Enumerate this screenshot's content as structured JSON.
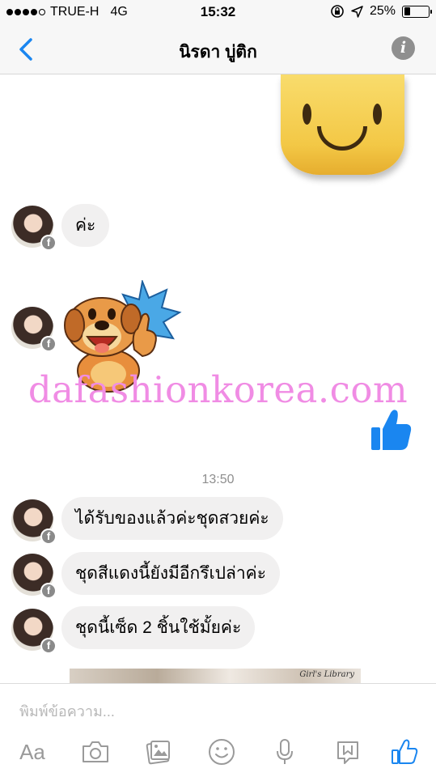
{
  "status_bar": {
    "carrier": "TRUE-H",
    "network": "4G",
    "time": "15:32",
    "battery_text": "25%",
    "battery_level": 0.25,
    "signal_bars_filled": 4,
    "signal_bars_total": 5
  },
  "header": {
    "title": "นิรดา บู่ติก",
    "info_label": "i"
  },
  "conversation": {
    "messages_before": [
      {
        "text": "ค่ะ"
      }
    ],
    "timestamp": "13:50",
    "messages_after": [
      {
        "text": "ได้รับของแล้วค่ะชุดสวยค่ะ"
      },
      {
        "text": "ชุดสีแดงนี้ยังมีอีกรึเปล่าค่ะ"
      },
      {
        "text": "ชุดนี้เซ็ด 2 ชิ้นใช้มั้ยค่ะ"
      }
    ],
    "photo_preview_text": "Girl's Library",
    "watermark": "dafashionkorea.com",
    "badge_letter": "f"
  },
  "composer": {
    "placeholder": "พิมพ์ข้อความ...",
    "aa_label": "Aa",
    "icons": [
      "text-format-icon",
      "camera-icon",
      "gallery-icon",
      "emoji-icon",
      "microphone-icon",
      "sticker-icon",
      "like-icon"
    ]
  },
  "colors": {
    "accent": "#1a86f0",
    "nav_background": "#f7f7f7",
    "bubble_gray": "#f1f0f0",
    "icon_gray": "#9a9a9a",
    "watermark": "#f08ce4"
  }
}
